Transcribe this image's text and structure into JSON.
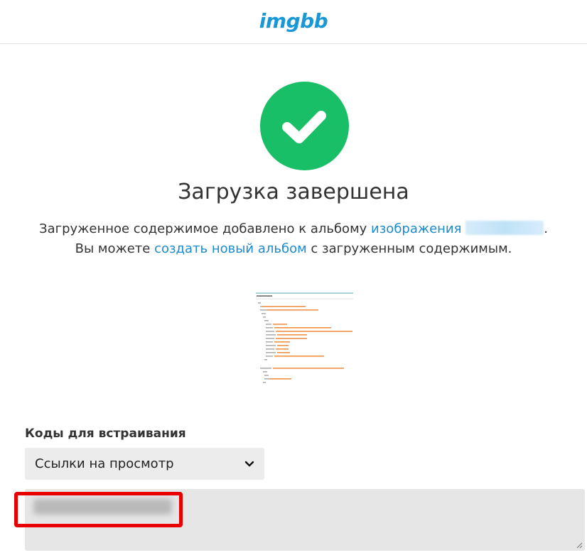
{
  "header": {
    "logo_text": "imgbb"
  },
  "status": {
    "icon": "check-icon",
    "color": "#18bf66"
  },
  "title": "Загрузка завершена",
  "description": {
    "part1": "Загруженное содержимое добавлено к альбому ",
    "album_link": "изображения",
    "part2": ". Вы можете ",
    "create_link": "создать новый альбом",
    "part3": " с загруженным содержимым."
  },
  "embed": {
    "label": "Коды для встраивания",
    "selected_option": "Ссылки на просмотр"
  },
  "colors": {
    "accent": "#1a98d6",
    "link": "#1a8bd0",
    "highlight": "#e80000"
  }
}
